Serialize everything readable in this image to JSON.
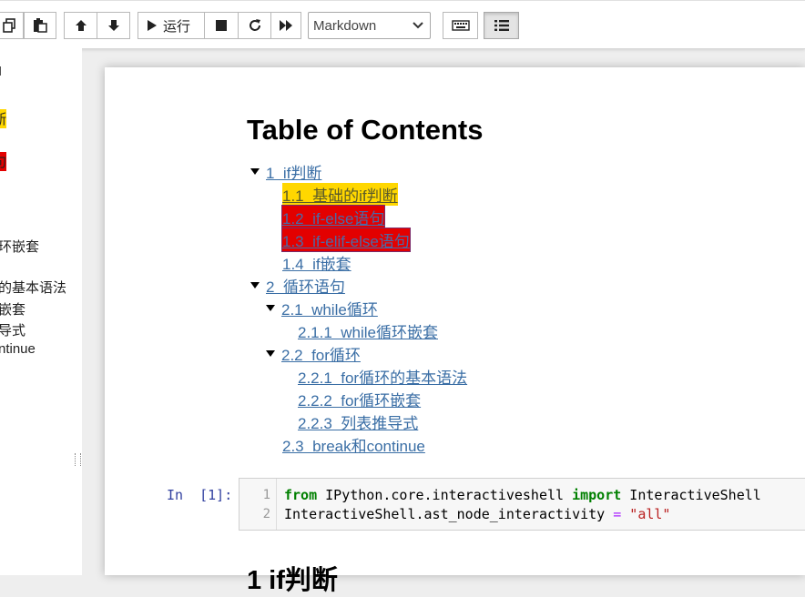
{
  "toolbar": {
    "run_label": "运行",
    "cell_type_selected": "Markdown"
  },
  "sidebar": {
    "items": [
      {
        "text": "I"
      },
      {
        "text": "断"
      },
      {
        "text": "句"
      },
      {
        "text": "环嵌套"
      },
      {
        "text": "的基本语法"
      },
      {
        "text": "嵌套"
      },
      {
        "text": "导式"
      },
      {
        "text": "ntinue"
      }
    ]
  },
  "toc": {
    "title": "Table of Contents",
    "items": [
      {
        "number": "1",
        "label": "if判断",
        "collapsible": true,
        "highlight": "none"
      },
      {
        "number": "1.1",
        "label": "基础的if判断",
        "collapsible": false,
        "highlight": "yellow"
      },
      {
        "number": "1.2",
        "label": "if-else语句",
        "collapsible": false,
        "highlight": "red"
      },
      {
        "number": "1.3",
        "label": "if-elif-else语句",
        "collapsible": false,
        "highlight": "red"
      },
      {
        "number": "1.4",
        "label": "if嵌套",
        "collapsible": false,
        "highlight": "none"
      },
      {
        "number": "2",
        "label": "循环语句",
        "collapsible": true,
        "highlight": "none"
      },
      {
        "number": "2.1",
        "label": "while循环",
        "collapsible": true,
        "highlight": "none"
      },
      {
        "number": "2.1.1",
        "label": "while循环嵌套",
        "collapsible": false,
        "highlight": "none"
      },
      {
        "number": "2.2",
        "label": "for循环",
        "collapsible": true,
        "highlight": "none"
      },
      {
        "number": "2.2.1",
        "label": "for循环的基本语法",
        "collapsible": false,
        "highlight": "none"
      },
      {
        "number": "2.2.2",
        "label": "for循环嵌套",
        "collapsible": false,
        "highlight": "none"
      },
      {
        "number": "2.2.3",
        "label": "列表推导式",
        "collapsible": false,
        "highlight": "none"
      },
      {
        "number": "2.3",
        "label": "break和continue",
        "collapsible": false,
        "highlight": "none"
      }
    ]
  },
  "cell": {
    "prompt": "In  [1]:",
    "line_numbers": [
      "1",
      "2"
    ],
    "code": [
      [
        {
          "t": "from",
          "c": "kw"
        },
        {
          "t": " IPython.core.interactiveshell ",
          "c": ""
        },
        {
          "t": "import",
          "c": "kw"
        },
        {
          "t": " InteractiveShell",
          "c": ""
        }
      ],
      [
        {
          "t": "InteractiveShell.ast_node_interactivity ",
          "c": ""
        },
        {
          "t": "=",
          "c": "op"
        },
        {
          "t": " ",
          "c": ""
        },
        {
          "t": "\"all\"",
          "c": "str"
        }
      ]
    ]
  },
  "next_heading": "1  if判断",
  "colors": {
    "toc_link": "#3a6ea5",
    "highlight_yellow": "#ffd700",
    "highlight_red": "#e30000",
    "prompt": "#303f9f",
    "keyword": "#008000",
    "string": "#ba2121"
  }
}
